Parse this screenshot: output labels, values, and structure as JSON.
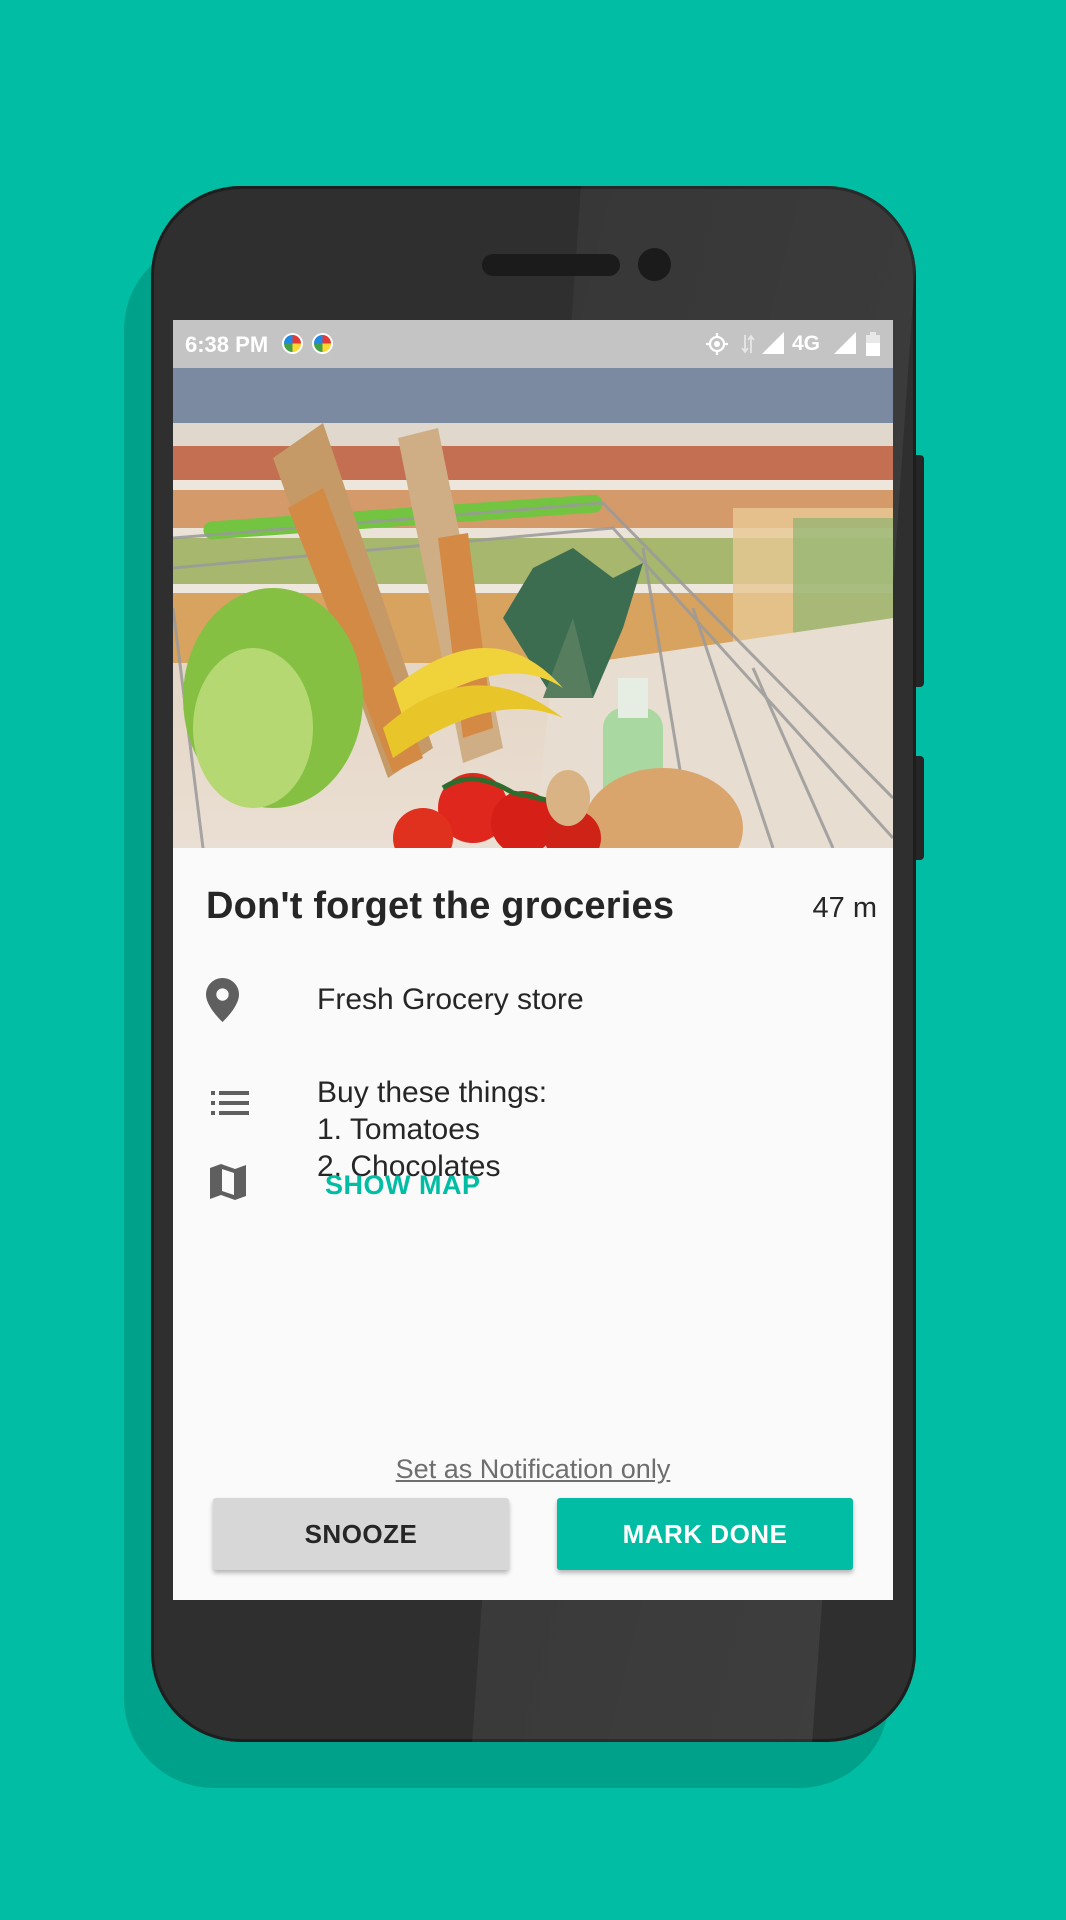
{
  "status_bar": {
    "time": "6:38 PM",
    "network": "4G",
    "icons": [
      "notification-icon",
      "notification-icon",
      "location-icon",
      "data-arrows-icon",
      "signal-icon",
      "signal-icon",
      "battery-icon"
    ]
  },
  "reminder": {
    "title": "Don't forget the groceries",
    "distance": "47 m",
    "location": "Fresh Grocery store",
    "notes": [
      "Buy these things:",
      "1. Tomatoes",
      "2. Chocolates"
    ],
    "show_map_label": "SHOW MAP"
  },
  "actions": {
    "notification_only_label": "Set as Notification only",
    "snooze_label": "SNOOZE",
    "done_label": "MARK DONE"
  },
  "colors": {
    "accent": "#00bda3",
    "background": "#00bda3",
    "status_bar": "#c4c4c4",
    "snooze_button": "#d7d7d7"
  }
}
